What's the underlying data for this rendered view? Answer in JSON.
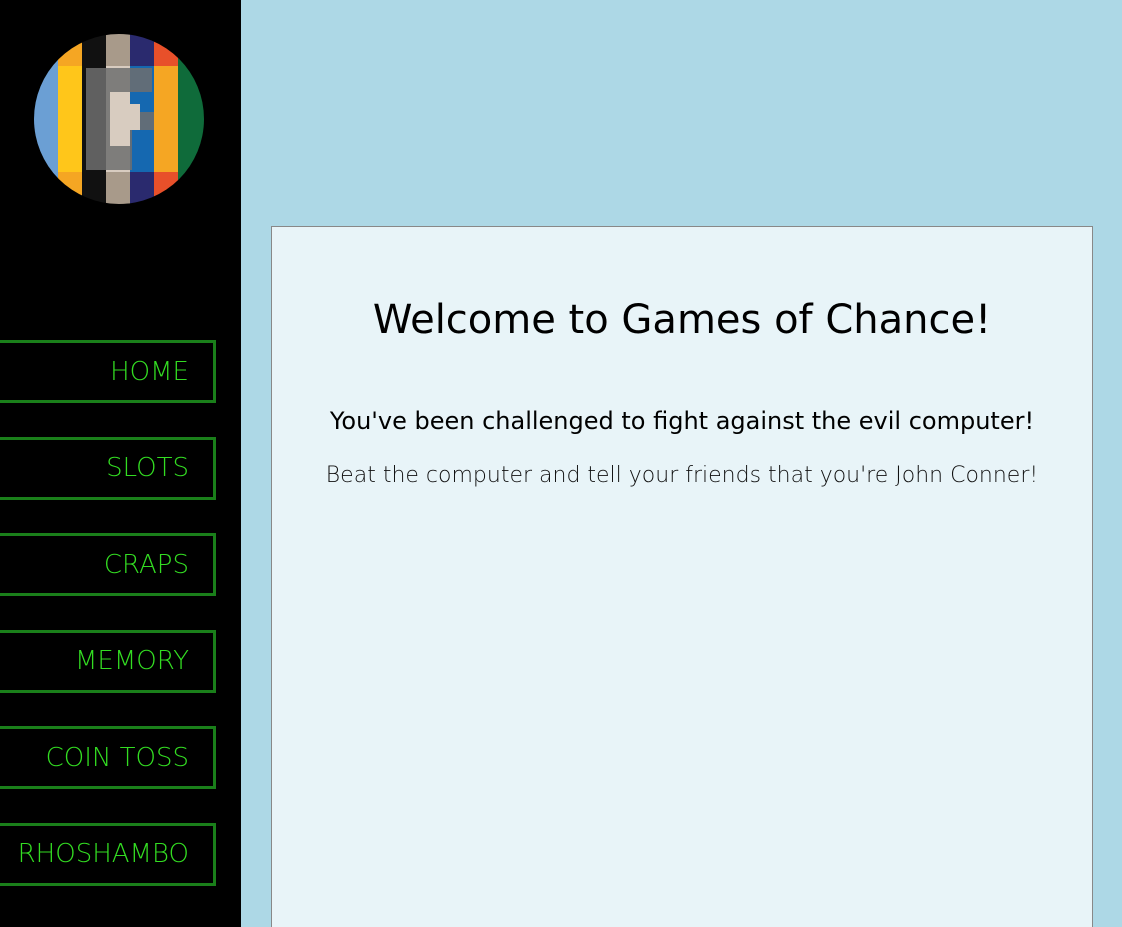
{
  "sidebar": {
    "logo_icon": "games-of-chance-g-logo",
    "items": [
      {
        "label": "HOME"
      },
      {
        "label": "SLOTS"
      },
      {
        "label": "CRAPS"
      },
      {
        "label": "MEMORY"
      },
      {
        "label": "COIN TOSS"
      },
      {
        "label": "RHOSHAMBO"
      }
    ]
  },
  "main": {
    "title": "Welcome to Games of Chance!",
    "subtitle": "You've been challenged to fight against the evil computer!",
    "tagline": "Beat the computer and tell your friends that you're John Conner!"
  },
  "colors": {
    "page_background": "#add8e6",
    "sidebar_background": "#000000",
    "nav_border": "#1a7f1a",
    "nav_text": "#33dd22",
    "content_background": "#e8f4f8"
  }
}
